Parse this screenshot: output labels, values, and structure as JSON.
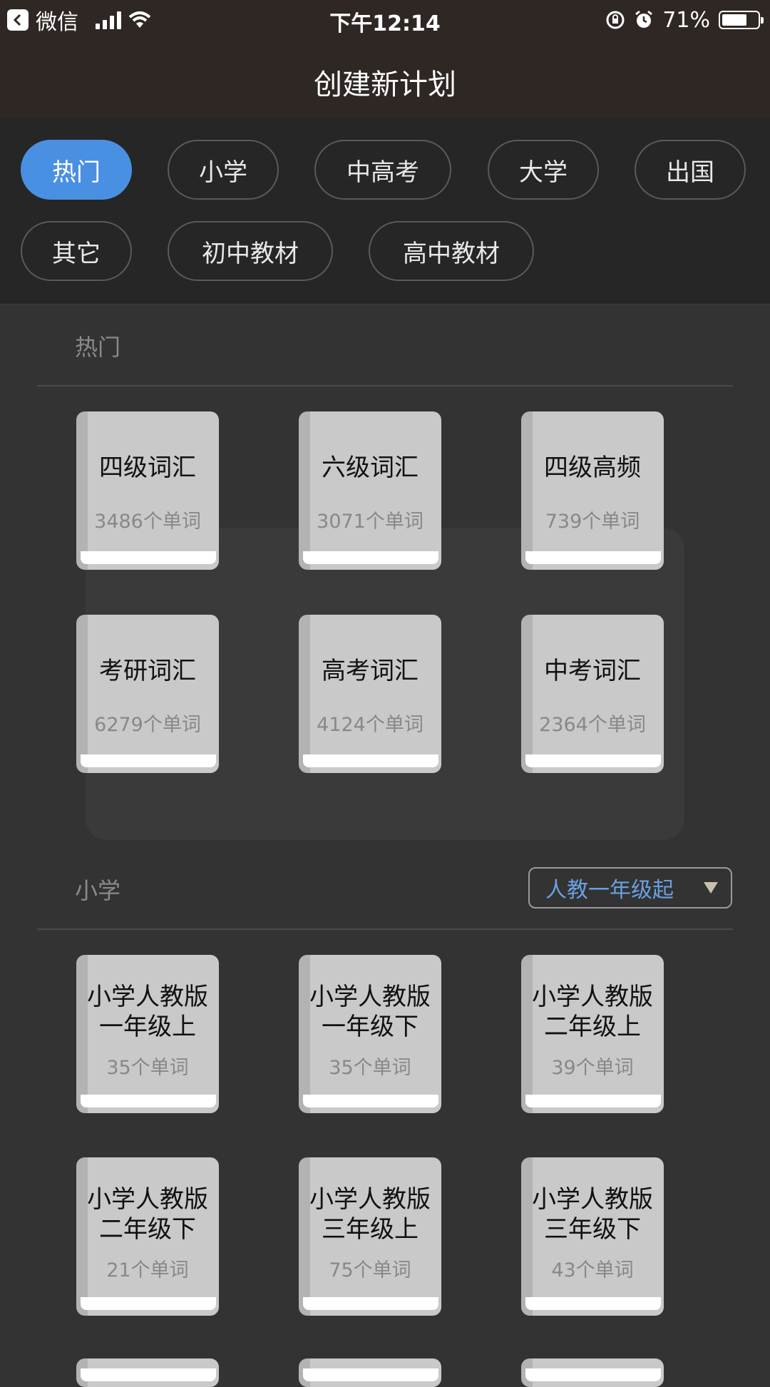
{
  "status_bar": {
    "back_app": "微信",
    "time": "下午12:14",
    "battery": "71%",
    "battery_level": 0.71
  },
  "nav": {
    "title": "创建新计划"
  },
  "categories": [
    "热门",
    "小学",
    "中高考",
    "大学",
    "出国",
    "其它",
    "初中教材",
    "高中教材"
  ],
  "active_category": "热门",
  "sections": {
    "hot": {
      "label": "热门",
      "books": [
        {
          "name": "四级词汇",
          "count": "3486个单词"
        },
        {
          "name": "六级词汇",
          "count": "3071个单词"
        },
        {
          "name": "四级高频",
          "count": "739个单词"
        },
        {
          "name": "考研词汇",
          "count": "6279个单词"
        },
        {
          "name": "高考词汇",
          "count": "4124个单词"
        },
        {
          "name": "中考词汇",
          "count": "2364个单词"
        }
      ]
    },
    "primary": {
      "label": "小学",
      "dropdown": "人教一年级起",
      "books": [
        {
          "name1": "小学人教版",
          "name2": "一年级上",
          "count": "35个单词"
        },
        {
          "name1": "小学人教版",
          "name2": "一年级下",
          "count": "35个单词"
        },
        {
          "name1": "小学人教版",
          "name2": "二年级上",
          "count": "39个单词"
        },
        {
          "name1": "小学人教版",
          "name2": "二年级下",
          "count": "21个单词"
        },
        {
          "name1": "小学人教版",
          "name2": "三年级上",
          "count": "75个单词"
        },
        {
          "name1": "小学人教版",
          "name2": "三年级下",
          "count": "43个单词"
        }
      ]
    }
  },
  "colors": {
    "accent": "#4a90e2",
    "background": "#333333",
    "header": "#2e2724",
    "dropdown_text": "#6aa0e0"
  }
}
